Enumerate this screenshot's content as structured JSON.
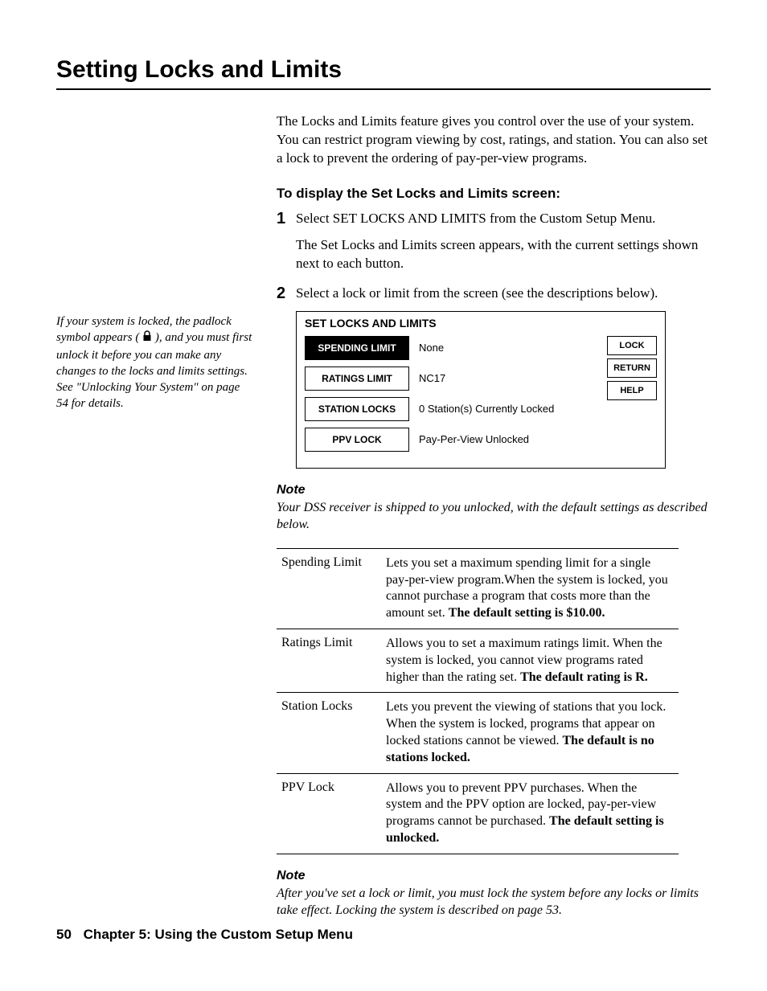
{
  "title": "Setting Locks and Limits",
  "margin_note_pre": "If your system is locked, the padlock symbol appears (",
  "margin_note_post": "), and you must first unlock it before you can make any changes to the locks and limits settings. See \"Unlocking Your System\" on page 54 for details.",
  "intro": "The Locks and Limits feature gives you control over the use of your system. You can restrict program viewing by cost, ratings, and station. You can also set a lock to prevent the ordering of pay-per-view programs.",
  "subhead": "To display the Set Locks and Limits screen:",
  "steps": [
    {
      "num": "1",
      "text": "Select SET LOCKS AND LIMITS from the Custom Setup Menu.",
      "sub": "The Set Locks and Limits screen appears, with the current settings shown next to each button."
    },
    {
      "num": "2",
      "text": "Select a lock or limit from the screen (see the descriptions below)."
    }
  ],
  "ui": {
    "title": "SET LOCKS AND LIMITS",
    "rows": [
      {
        "label": "SPENDING LIMIT",
        "value": "None",
        "selected": true
      },
      {
        "label": "RATINGS LIMIT",
        "value": "NC17",
        "selected": false
      },
      {
        "label": "STATION LOCKS",
        "value": "0 Station(s) Currently Locked",
        "selected": false
      },
      {
        "label": "PPV LOCK",
        "value": "Pay-Per-View Unlocked",
        "selected": false
      }
    ],
    "side": [
      "LOCK",
      "RETURN",
      "HELP"
    ]
  },
  "note1_head": "Note",
  "note1_body": "Your DSS receiver is shipped to you unlocked, with the default settings as described below.",
  "desc": [
    {
      "label": "Spending Limit",
      "text": "Lets you set a maximum spending limit for a single pay-per-view program.When the system is locked, you cannot purchase a program that costs more than the amount set. ",
      "bold": "The default setting is $10.00."
    },
    {
      "label": "Ratings Limit",
      "text": "Allows you to set a maximum ratings limit. When the system is locked, you cannot view programs rated higher than the rating set. ",
      "bold": "The default rating is R."
    },
    {
      "label": "Station Locks",
      "text": "Lets you prevent the viewing of stations that you lock. When the system is locked, programs that appear on locked stations cannot be viewed. ",
      "bold": "The default is no stations locked."
    },
    {
      "label": "PPV Lock",
      "text": "Allows you to prevent PPV purchases. When the system and the PPV option are locked, pay-per-view programs cannot be purchased. ",
      "bold": "The default setting is unlocked."
    }
  ],
  "note2_head": "Note",
  "note2_body": "After you've set a lock or limit, you must lock the system before any locks or limits take effect. Locking the system is described on page 53.",
  "footer_page": "50",
  "footer_chapter": "Chapter 5: Using the Custom Setup Menu"
}
